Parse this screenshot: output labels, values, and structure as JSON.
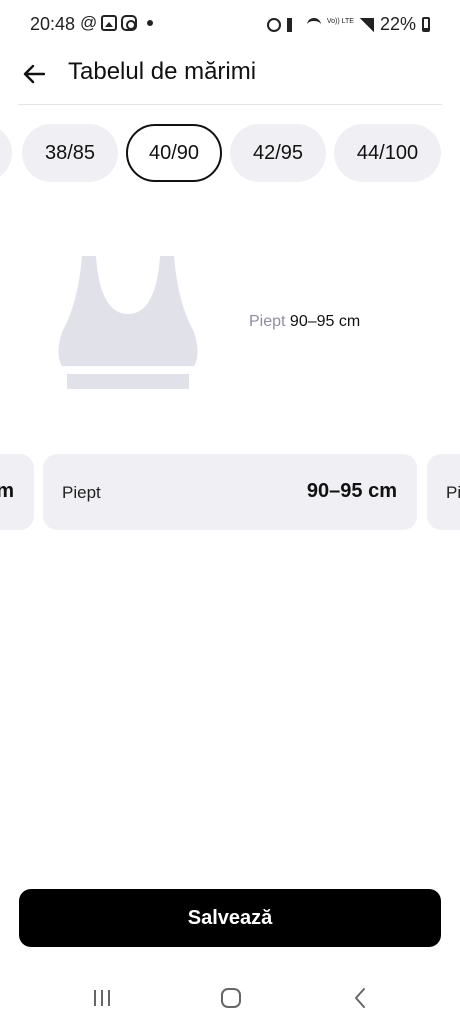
{
  "status_bar": {
    "time": "20:48",
    "at_symbol": "@",
    "battery_text": "22%",
    "lte_text": "Vo)) LTE",
    "left_icons": [
      "at-icon",
      "image-icon",
      "instagram-icon",
      "dot-icon"
    ],
    "right_icons": [
      "alarm-icon",
      "mute-icon",
      "wifi-icon",
      "lte-icon",
      "signal-icon",
      "battery-icon"
    ]
  },
  "header": {
    "title": "Tabelul de mărimi",
    "back_icon": "arrow-left-icon"
  },
  "size_chips": [
    {
      "label": "38/85",
      "selected": false
    },
    {
      "label": "40/90",
      "selected": true
    },
    {
      "label": "42/95",
      "selected": false
    },
    {
      "label": "44/100",
      "selected": false
    }
  ],
  "illustration": {
    "icon": "sports-bra-icon",
    "color": "#e1e1e9",
    "caption_label": "Piept",
    "caption_value": "90–95 cm"
  },
  "cards": {
    "left_partial_value": "m",
    "main": {
      "label": "Piept",
      "value": "90–95 cm"
    },
    "right_partial_label": "Pi"
  },
  "actions": {
    "save_label": "Salvează"
  },
  "nav": {
    "items": [
      "recent-apps-icon",
      "home-icon",
      "back-icon"
    ]
  },
  "colors": {
    "chip_bg": "#efeff4",
    "accent": "#000000",
    "muted_text": "#8e8ea0"
  }
}
